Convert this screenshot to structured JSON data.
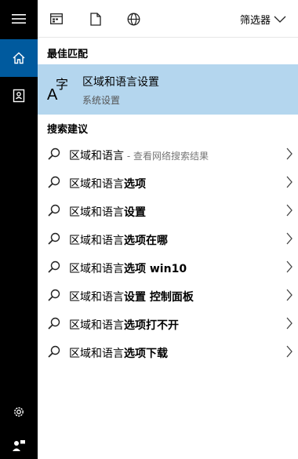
{
  "topbar": {
    "filter_label": "筛选器"
  },
  "sections": {
    "best_match": "最佳匹配",
    "suggestions": "搜索建议"
  },
  "best_match": {
    "title": "区域和语言设置",
    "subtitle": "系统设置"
  },
  "suggestions": [
    {
      "prefix": "区域和语言",
      "bold": "",
      "hint": " - 查看网络搜索结果"
    },
    {
      "prefix": "区域和语言",
      "bold": "选项",
      "hint": ""
    },
    {
      "prefix": "区域和语言",
      "bold": "设置",
      "hint": ""
    },
    {
      "prefix": "区域和语言",
      "bold": "选项在哪",
      "hint": ""
    },
    {
      "prefix": "区域和语言",
      "bold": "选项 win10",
      "hint": ""
    },
    {
      "prefix": "区域和语言",
      "bold": "设置 控制面板",
      "hint": ""
    },
    {
      "prefix": "区域和语言",
      "bold": "选项打不开",
      "hint": ""
    },
    {
      "prefix": "区域和语言",
      "bold": "选项下载",
      "hint": ""
    }
  ],
  "colors": {
    "rail": "#000000",
    "home_active": "#005a9e",
    "selected_row": "#b4d6ee"
  },
  "icons": {
    "rail": [
      "hamburger-menu-icon",
      "home-icon",
      "notebook-icon",
      "settings-gear-icon",
      "feedback-icon"
    ],
    "topbar": [
      "apps-icon",
      "documents-icon",
      "web-globe-icon",
      "chevron-down-icon"
    ],
    "rows": [
      "search-icon",
      "chevron-right-icon"
    ],
    "best_match": "region-language-icon"
  }
}
